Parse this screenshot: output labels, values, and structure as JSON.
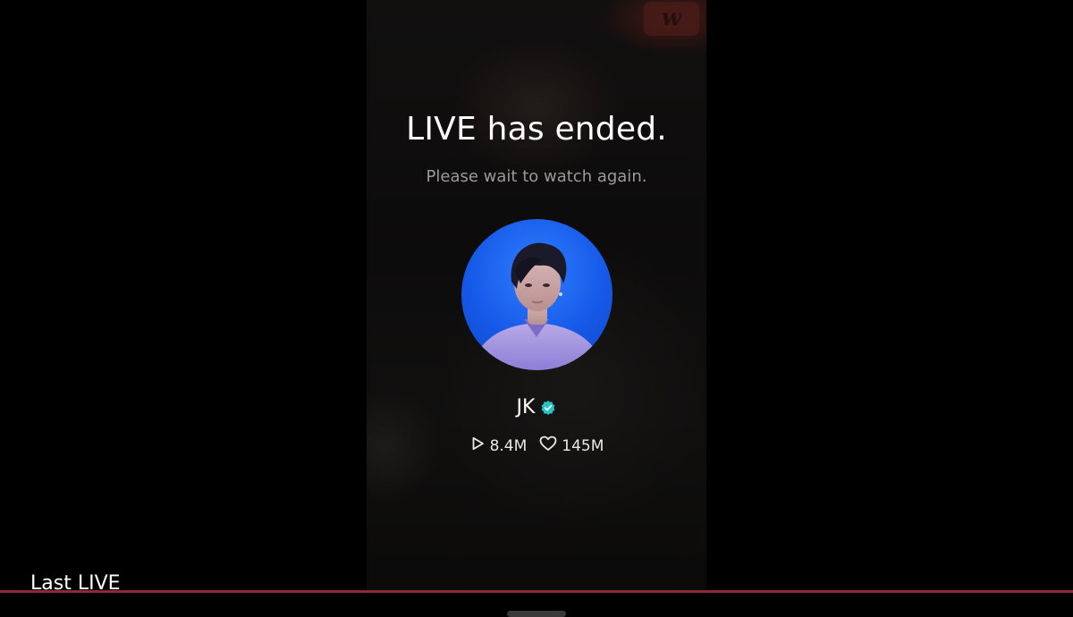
{
  "background_logo": "w",
  "stream": {
    "title": "LIVE has ended.",
    "subtitle": "Please wait to watch again."
  },
  "artist": {
    "name": "JK",
    "verified": true,
    "avatar_background": "#1a5ff0"
  },
  "stats": {
    "plays": "8.4M",
    "likes": "145M"
  },
  "footer": {
    "label": "Last LIVE",
    "progress_fraction": 1.0
  },
  "colors": {
    "verified_badge": "#23c4c4",
    "progress": "#8a2c36",
    "subtitle": "#9a9a9a"
  },
  "icons": {
    "plays": "play-outline-icon",
    "likes": "heart-outline-icon",
    "verified": "verified-badge-icon"
  }
}
